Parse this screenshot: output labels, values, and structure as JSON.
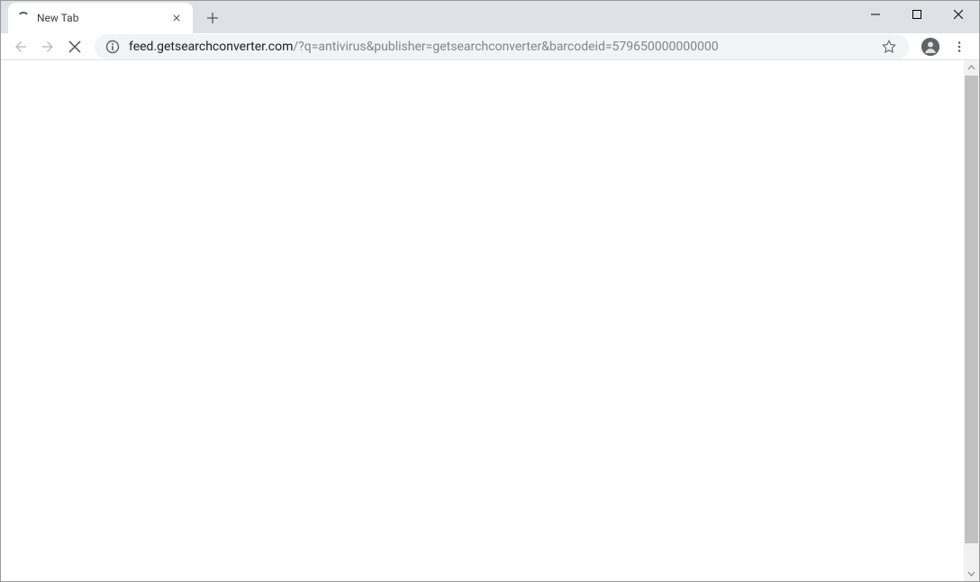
{
  "tabStrip": {
    "activeTab": {
      "title": "New Tab"
    }
  },
  "toolbar": {
    "url": {
      "domain": "feed.getsearchconverter.com",
      "path": "/?q=antivirus&publisher=getsearchconverter&barcodeid=579650000000000"
    }
  },
  "icons": {
    "close": "x",
    "plus": "+",
    "info": "i"
  }
}
